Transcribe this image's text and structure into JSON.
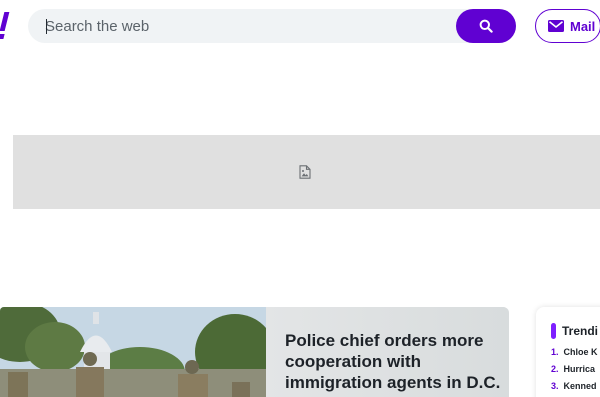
{
  "header": {
    "search": {
      "placeholder": "Search the web",
      "value": ""
    },
    "mail_label": "Mail",
    "icons": {
      "search": "search-icon",
      "mail": "mail-icon",
      "logo": "yahoo-logo"
    },
    "colors": {
      "brand": "#6001d2",
      "search_bg": "#f0f3f5"
    }
  },
  "ad": {
    "icon": "broken-image-icon",
    "background": "#e0e0e0"
  },
  "hero": {
    "headline": "Police chief orders more cooperation with immigration agents in D.C."
  },
  "trending": {
    "title": "Trendi",
    "items": [
      {
        "num": "1.",
        "label": "Chloe K"
      },
      {
        "num": "2.",
        "label": "Hurrica"
      },
      {
        "num": "3.",
        "label": "Kenned"
      }
    ]
  }
}
